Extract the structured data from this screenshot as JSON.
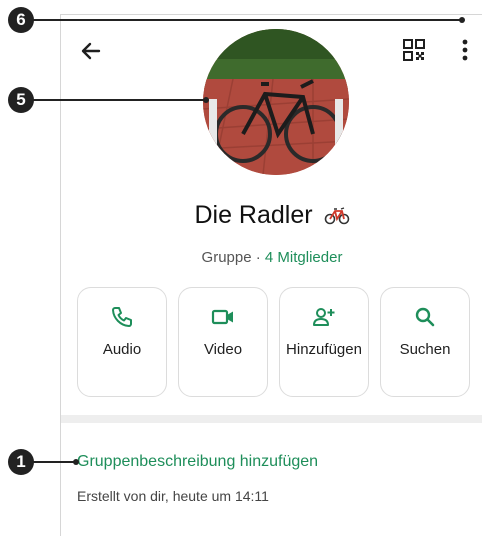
{
  "header": {
    "back_icon": "arrow-left-icon",
    "qr_icon": "qr-code-icon",
    "more_icon": "more-vertical-icon"
  },
  "group": {
    "name": "Die Radler",
    "name_emoji_icon": "bicycle-icon",
    "type_label": "Gruppe · ",
    "members_label": "4 Mitglieder"
  },
  "actions": [
    {
      "label": "Audio",
      "icon": "phone-icon"
    },
    {
      "label": "Video",
      "icon": "video-camera-icon"
    },
    {
      "label": "Hinzufügen",
      "icon": "add-person-icon"
    },
    {
      "label": "Suchen",
      "icon": "search-icon"
    }
  ],
  "description": {
    "link_label": "Gruppenbeschreibung hinzufügen",
    "created_text": "Erstellt von dir, heute um 14:11"
  },
  "callouts": [
    "6",
    "5",
    "1"
  ],
  "colors": {
    "accent": "#1e8e5a",
    "text": "#1f1f1f",
    "callout": "#222222"
  }
}
